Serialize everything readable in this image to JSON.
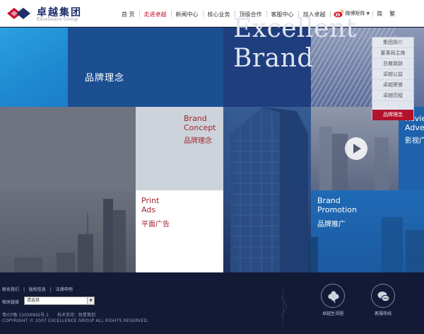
{
  "brand": {
    "name_cn": "卓越集团",
    "name_en": "Excellence Group"
  },
  "nav": {
    "items": [
      "首 页",
      "走进卓越",
      "新闻中心",
      "核心业务",
      "顶级合作",
      "客服中心",
      "加入卓越"
    ],
    "active_index": 1,
    "weibo_label": "微博矩阵",
    "lang_simplified": "简",
    "lang_traditional": "繁"
  },
  "hero": {
    "line1": "Excellent",
    "line2": "Brand",
    "tile_brand_cn": "品牌理念"
  },
  "tiles": {
    "brand_concept": {
      "en1": "Brand",
      "en2": "Concept",
      "cn": "品牌理念"
    },
    "video": {
      "en1": "Revie",
      "en2": "Adve",
      "cn": "影视广"
    },
    "print_ads": {
      "en1": "Print",
      "en2": "Ads",
      "cn": "平面广告"
    },
    "brand_promotion": {
      "en1": "Brand",
      "en2": "Promotion",
      "cn": "品牌推广"
    }
  },
  "submenu": {
    "items": [
      "集团简介",
      "董事局主席",
      "总裁致辞",
      "卓越公益",
      "卓越荣誉",
      "卓越历程"
    ],
    "selected": "品牌理念"
  },
  "footer": {
    "links": [
      "联系我们",
      "|",
      "版权信息",
      "|",
      "法律申明"
    ],
    "related_label": "相关链接",
    "select_value": "请选择",
    "icp": "粤ICP备 11026942号-1",
    "tech": "技术支持：牧星策划",
    "copyright": "COPYRIGHT © 2007 EXCELLENCE GROUP ALL RIGHTS RESERVED.",
    "btn_life": "卓越生活圈",
    "btn_hotline": "客服热线"
  },
  "colors": {
    "brand_red": "#c8102e",
    "navy": "#131a36",
    "blue": "#1e62ad"
  }
}
